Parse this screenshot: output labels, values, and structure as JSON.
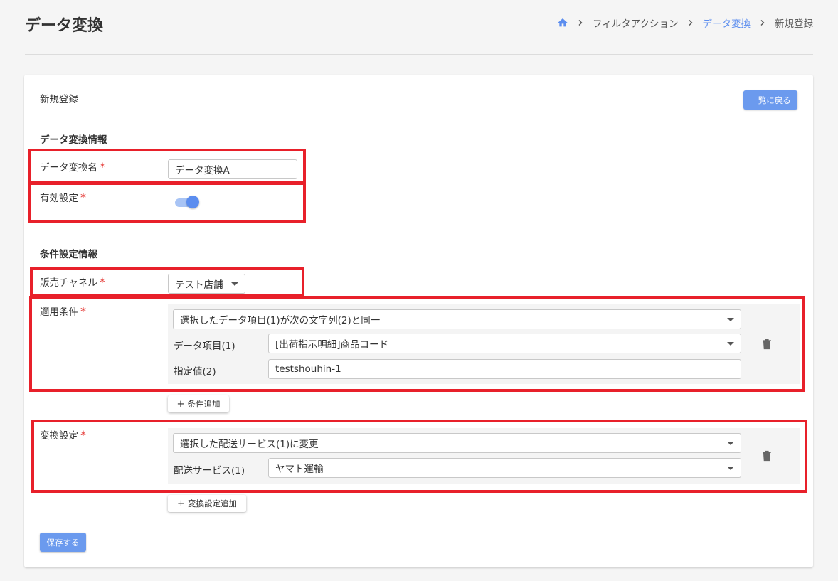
{
  "header": {
    "title": "データ変換",
    "breadcrumb": [
      "フィルタアクション",
      "データ変換",
      "新規登録"
    ]
  },
  "card": {
    "title": "新規登録",
    "back_button": "一覧に戻る",
    "section1": "データ変換情報",
    "name_label": "データ変換名",
    "name_value": "データ変換A",
    "enabled_label": "有効設定",
    "enabled": true,
    "section2": "条件設定情報",
    "channel_label": "販売チャネル",
    "channel_value": "テスト店舗",
    "condition_label": "適用条件",
    "condition_type": "選択したデータ項目(1)が次の文字列(2)と同一",
    "field1_label": "データ項目(1)",
    "field1_value": "[出荷指示明細]商品コード",
    "field2_label": "指定値(2)",
    "field2_value": "testshouhin-1",
    "add_condition": "条件追加",
    "conversion_label": "変換設定",
    "conversion_type": "選択した配送サービス(1)に変更",
    "delivery_label": "配送サービス(1)",
    "delivery_value": "ヤマト運輸",
    "add_conversion": "変換設定追加",
    "save_button": "保存する",
    "required_mark": "*"
  },
  "colors": {
    "accent": "#5b8def",
    "primary_button": "#6b9aee",
    "highlight": "#e8202a",
    "required": "#e53935"
  }
}
